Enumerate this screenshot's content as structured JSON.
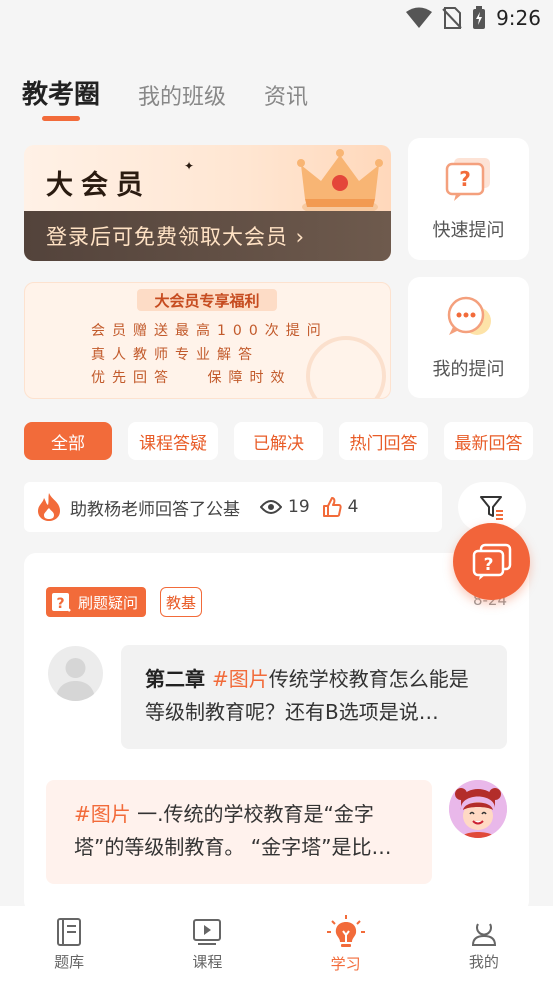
{
  "status": {
    "time": "9:26"
  },
  "tabs": [
    {
      "label": "教考圈"
    },
    {
      "label": "我的班级"
    },
    {
      "label": "资讯"
    }
  ],
  "membership_banner": {
    "title": "大会员",
    "cta": "登录后可免费领取大会员 ›"
  },
  "quick_ask": {
    "label": "快速提问"
  },
  "my_questions": {
    "label": "我的提问"
  },
  "perks_banner": {
    "title": "大会员专享福利",
    "lines": [
      "会员赠送最高100次提问",
      "真人教师专业解答",
      "优先回答　 保障时效"
    ]
  },
  "filters": [
    {
      "label": "全部"
    },
    {
      "label": "课程答疑"
    },
    {
      "label": "已解决"
    },
    {
      "label": "热门回答"
    },
    {
      "label": "最新回答"
    }
  ],
  "notice": {
    "text": "助教杨老师回答了公基",
    "views": "19",
    "likes": "4"
  },
  "post": {
    "tag_primary": "刷题疑问",
    "tag_secondary": "教基",
    "date": "8-24",
    "question_bold": "第二章 ",
    "question_hash": "#图片",
    "question_text": "传统学校教育怎么能是等级制教育呢？还有B选项是说…",
    "answer_hash": "#图片",
    "answer_text": " 一.传统的学校教育是“金字塔”的等级制教育。 “金字塔”是比…"
  },
  "bottom_nav": [
    {
      "label": "题库"
    },
    {
      "label": "课程"
    },
    {
      "label": "学习"
    },
    {
      "label": "我的"
    }
  ],
  "colors": {
    "accent": "#f26b3a",
    "background": "#f5f5f5"
  }
}
